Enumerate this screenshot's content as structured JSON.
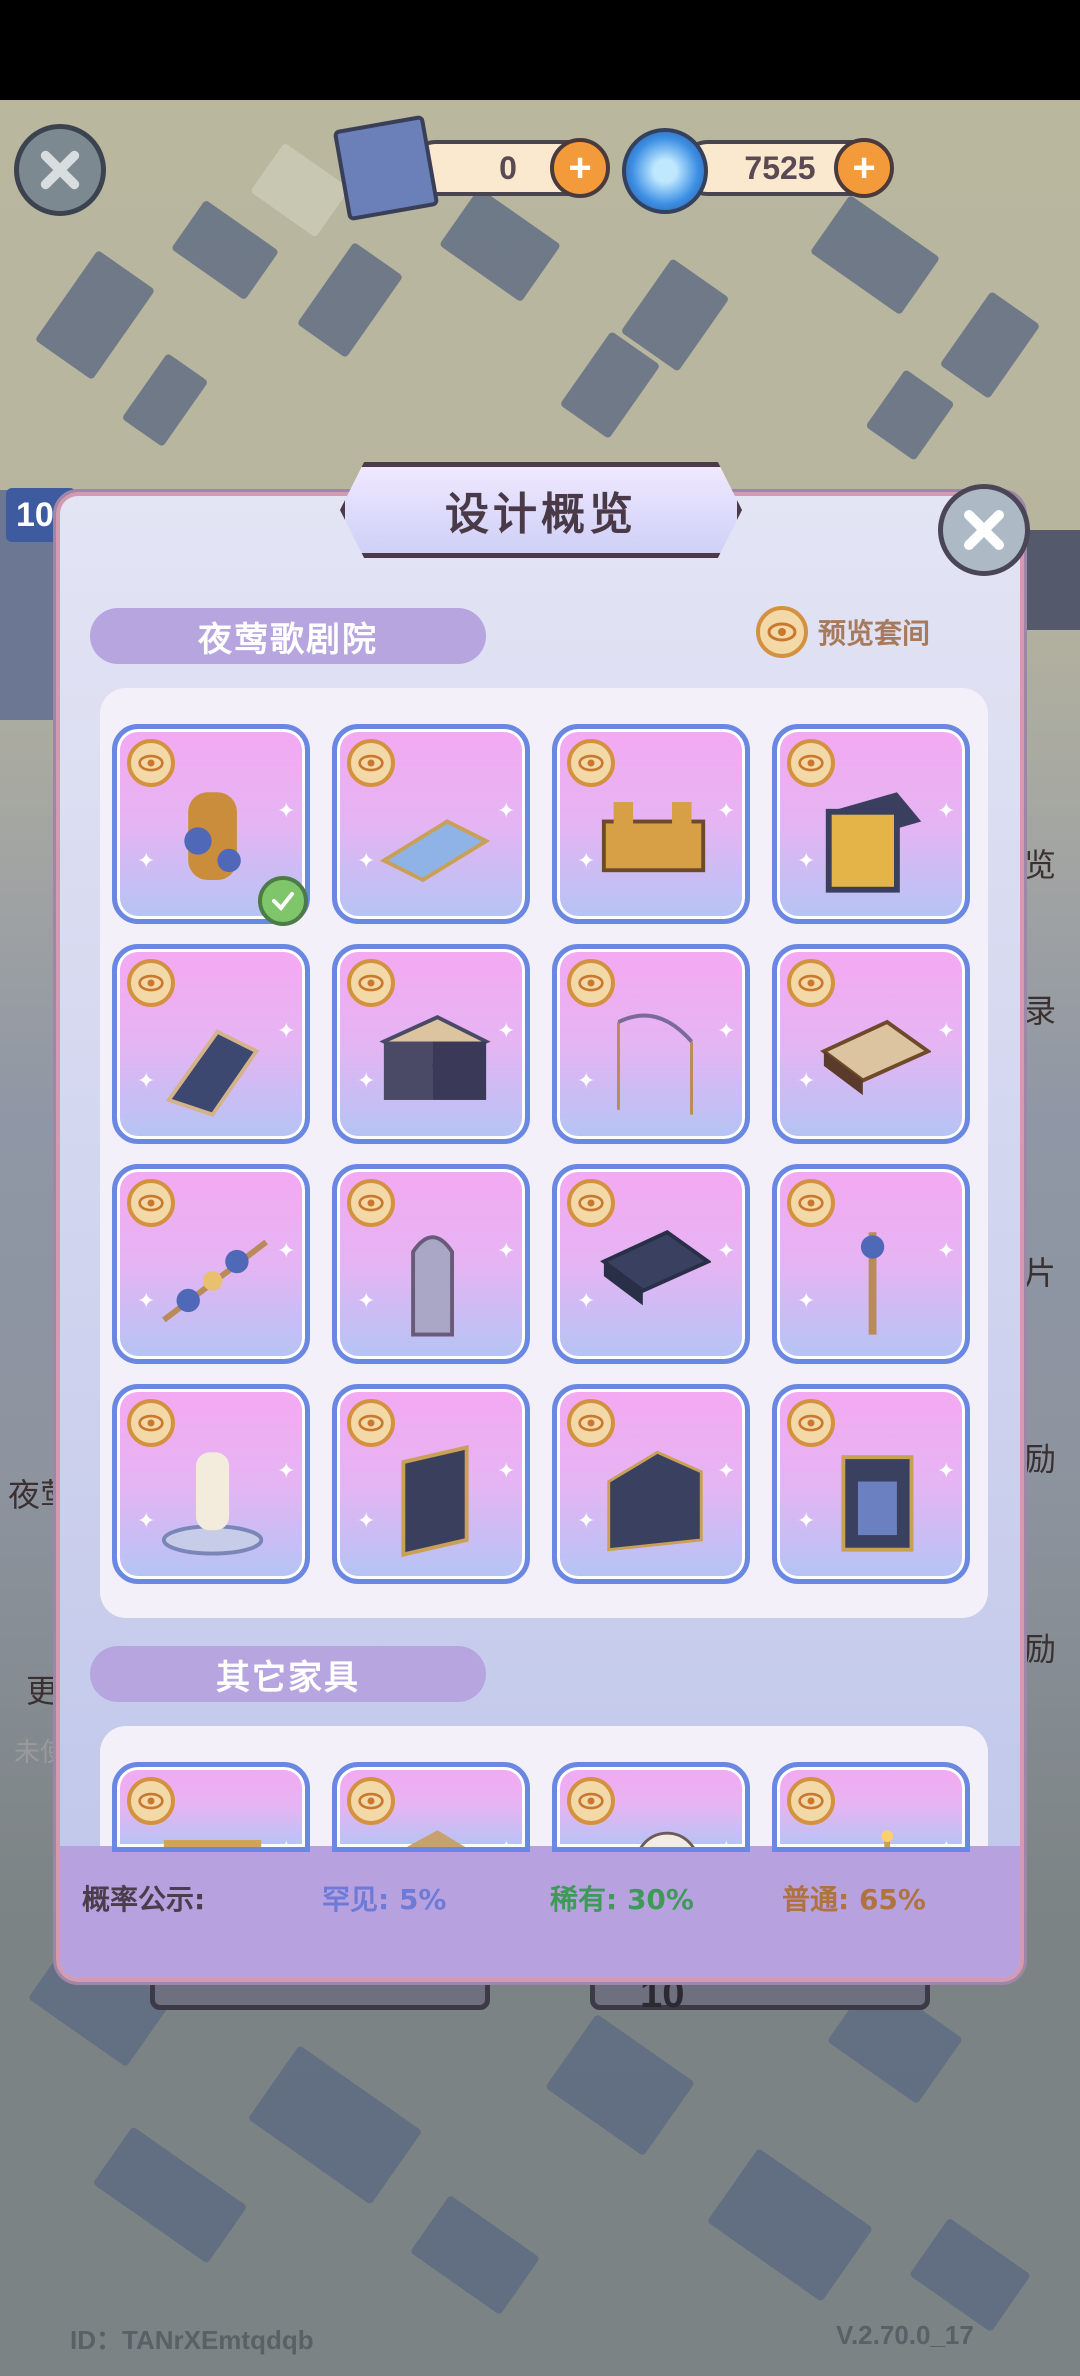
{
  "hud": {
    "scroll_count": "0",
    "gem_count": "7525"
  },
  "panel": {
    "title": "设计概览",
    "section1_label": "夜莺歌剧院",
    "preview_label": "预览套间",
    "section2_label": "其它家具",
    "owned_item_index": 0
  },
  "rates": {
    "label": "概率公示:",
    "rare": "罕见: 5%",
    "uncommon": "稀有: 30%",
    "common": "普通: 65%",
    "colors": {
      "rare": "#6e7ad8",
      "uncommon": "#3f9a5a",
      "common": "#b0733e"
    }
  },
  "background_text": {
    "left1": "夜莺",
    "left2": "更",
    "left3": "未使",
    "right1": "览",
    "right2": "录",
    "right3": "片",
    "right4": "励",
    "right5": "励",
    "left_badge": "10",
    "bottom_badge": "10"
  },
  "footer": {
    "id": "ID：TANrXEmtqdqb",
    "version": "V.2.70.0_17"
  }
}
